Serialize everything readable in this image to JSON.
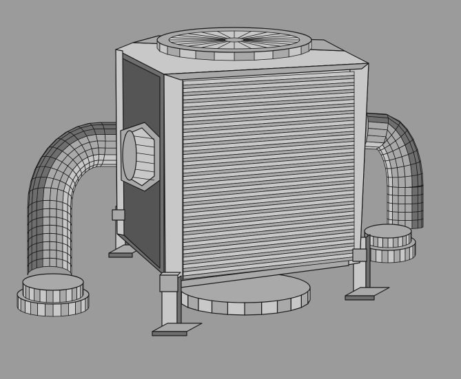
{
  "scene": {
    "subject": "wireframe-3d-model",
    "background_color": "#9b9b9b",
    "shade_colors": {
      "light": "#c8c8c8",
      "mid": "#a9a9a9",
      "dark": "#6e6e6e",
      "darker": "#555555",
      "line": "#1a1a1a"
    },
    "louver_count": 27,
    "pipe_segments": 16,
    "pipe_rings": 6,
    "fan_segments": 24,
    "legs": 4
  }
}
